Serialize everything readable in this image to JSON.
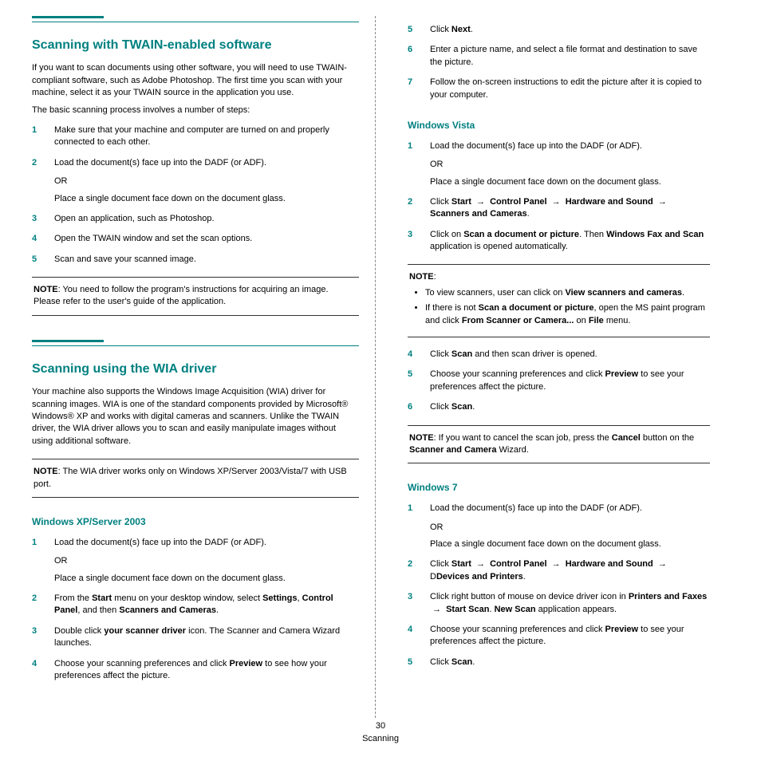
{
  "left": {
    "h2a": "Scanning with TWAIN-enabled software",
    "p1": "If you want to scan documents using other software, you will need to use TWAIN-compliant software, such as Adobe Photoshop. The first time you scan with your machine, select it as your TWAIN source in the application you use.",
    "p2": "The basic scanning process involves a number of steps:",
    "s1": "Make sure that your machine and computer are turned on and properly connected to each other.",
    "s2a": "Load the document(s) face up into the DADF (or ADF).",
    "or": "OR",
    "s2b": "Place a single document face down on the document glass.",
    "s3": "Open an application, such as Photoshop.",
    "s4": "Open the TWAIN window and set the scan options.",
    "s5": "Scan and save your scanned image.",
    "note1_label": "NOTE",
    "note1": ": You need to follow the program's instructions for acquiring an image. Please refer to the user's guide of the application.",
    "h2b": "Scanning using the WIA driver",
    "p3": "Your machine also supports the Windows Image Acquisition (WIA) driver for scanning images. WIA is one of the standard components provided by Microsoft® Windows® XP and works with digital cameras and scanners. Unlike the TWAIN driver, the WIA driver allows you to scan and easily manipulate images without using additional software.",
    "note2_label": "NOTE",
    "note2": ": The WIA driver works only on Windows XP/Server 2003/Vista/7 with USB port.",
    "h3a": "Windows XP/Server 2003",
    "xs1a": "Load the document(s) face up into the DADF (or ADF).",
    "xs1b": "Place a single document face down on the document glass.",
    "xs2a": "From the ",
    "xs2_start": "Start",
    "xs2b": " menu on your desktop window, select ",
    "xs2_settings": "Settings",
    "xs2c": ", ",
    "xs2_cp": "Control Panel",
    "xs2d": ", and then ",
    "xs2_sc": "Scanners and Cameras",
    "xs2e": ".",
    "xs3a": "Double click ",
    "xs3_icon": "your scanner driver",
    "xs3b": " icon. The Scanner and Camera Wizard launches.",
    "xs4a": "Choose your scanning preferences and click ",
    "xs4_prev": "Preview",
    "xs4b": " to see how your preferences affect the picture."
  },
  "right": {
    "r5a": "Click ",
    "r5_next": "Next",
    "r5b": ".",
    "r6": "Enter a picture name, and select a file format and destination to save the picture.",
    "r7": "Follow the on-screen instructions to edit the picture after it is copied to your computer.",
    "h3b": "Windows Vista",
    "v1a": "Load the document(s) face up into the DADF (or ADF).",
    "or": "OR",
    "v1b": " Place a single document face down on the document glass.",
    "v2a": "Click ",
    "v2_start": "Start",
    "arrow": "→",
    "v2_cp": "Control Panel",
    "v2_hs": "Hardware and Sound",
    "v2_sc": "Scanners and Cameras",
    "v2b": ".",
    "v3a": "Click on ",
    "v3_scan": "Scan a document or picture",
    "v3b": ". Then ",
    "v3_wfs": "Windows Fax and Scan",
    "v3c": " application is opened automatically.",
    "note3_label": "NOTE",
    "note3a": "To view scanners, user can click on ",
    "note3_vsc": "View scanners and cameras",
    "note3a2": ".",
    "note3b": "If there is not ",
    "note3_sdp": "Scan a document or picture",
    "note3b2": ", open the MS paint program and click ",
    "note3_fsc": "From Scanner or Camera...",
    "note3b3": " on ",
    "note3_file": "File",
    "note3b4": " menu.",
    "v4a": "Click ",
    "v4_scan": "Scan",
    "v4b": " and then scan driver is opened.",
    "v5a": "Choose your scanning preferences and click ",
    "v5_prev": "Preview",
    "v5b": " to see your preferences affect the picture.",
    "v6a": "Click ",
    "v6_scan": "Scan",
    "v6b": ".",
    "note4_label": "NOTE",
    "note4a": ": If you want to  cancel the scan job, press the ",
    "note4_cancel": "Cancel",
    "note4b": " button on the ",
    "note4_scw": "Scanner and Camera",
    "note4c": " Wizard.",
    "h3c": "Windows 7",
    "w1a": "Load the document(s) face up into the DADF (or ADF).",
    "w1b": " Place a single document face down on the document glass.",
    "w2a": "Click ",
    "w2_start": "Start",
    "w2_cp": "Control Panel",
    "w2_hs": "Hardware and Sound",
    "w2_dp": "Devices and Printers",
    "w2d": "D",
    "w2b": ".",
    "w3a": "Click right button of mouse on device driver icon in ",
    "w3_ps": "Printers and Faxes",
    "w3_ss": "Start Scan",
    "w3_ns": "New Scan",
    "w3b": " application appears.",
    "w4a": "Choose your scanning preferences and click ",
    "w4_prev": "Preview",
    "w4b": " to see your preferences affect the picture.",
    "w5a": "Click ",
    "w5_scan": "Scan",
    "w5b": "."
  },
  "footer": {
    "page": "30",
    "label": "Scanning"
  }
}
